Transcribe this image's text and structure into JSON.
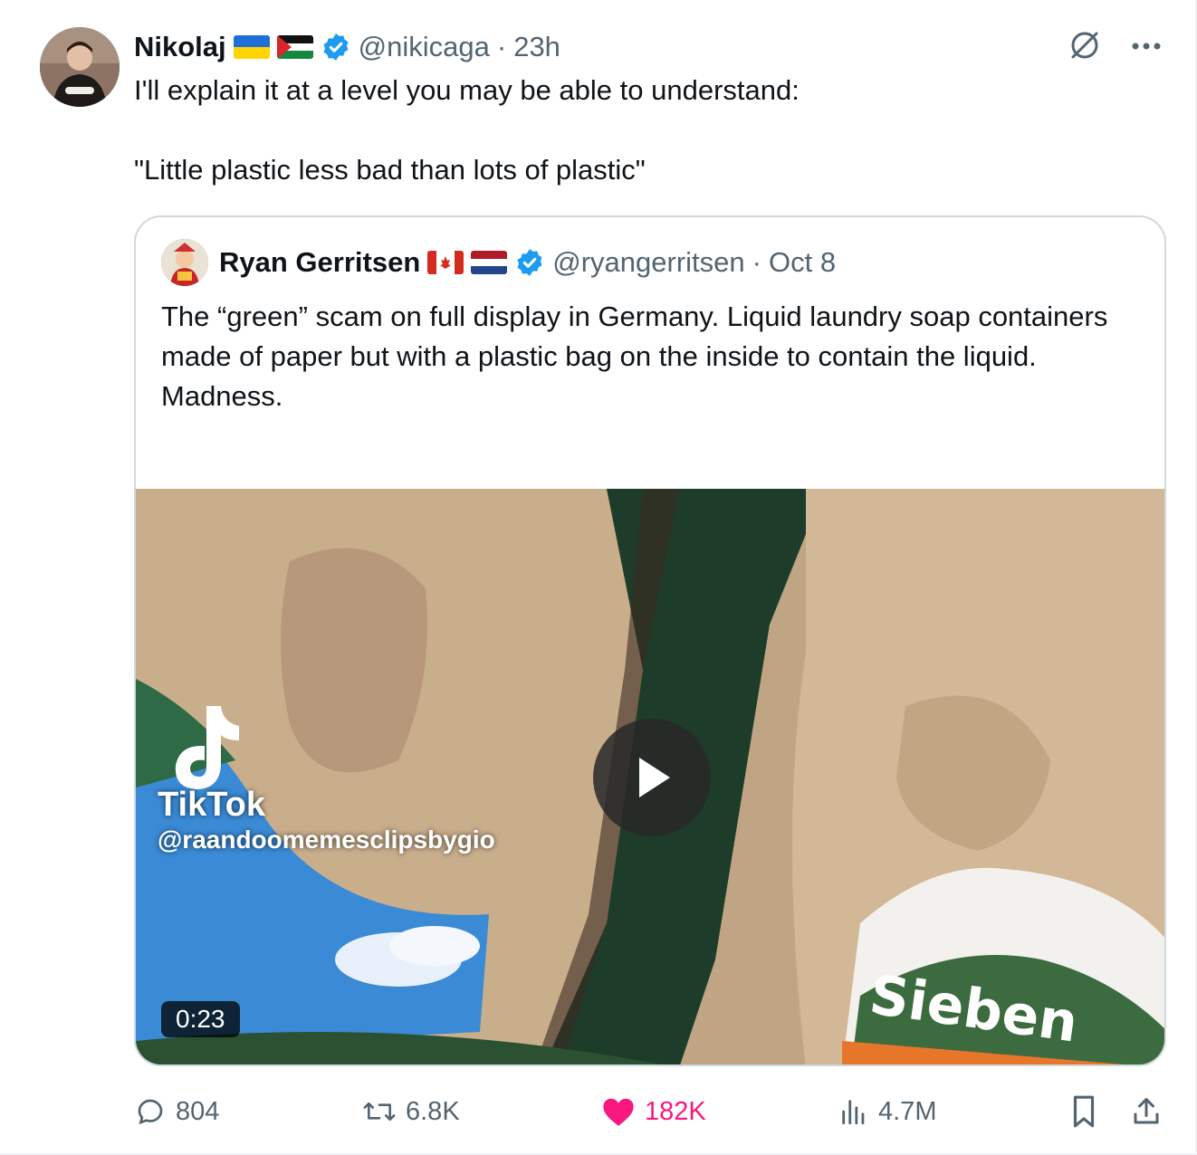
{
  "tweet": {
    "author_name": "Nikolaj",
    "handle": "@nikicaga",
    "separator": "·",
    "time": "23h",
    "text": "I'll explain it at a level you may be able to understand:\n\n\"Little plastic less bad than lots of plastic\""
  },
  "quote": {
    "author_name": "Ryan Gerritsen",
    "handle": "@ryangerritsen",
    "separator": "·",
    "date": "Oct 8",
    "text": "The “green” scam on full display in Germany. Liquid laundry soap containers made of paper but with a plastic bag on the inside to contain the liquid.\nMadness.",
    "media": {
      "duration": "0:23",
      "watermark_name": "TikTok",
      "watermark_user": "@raandoomemesclipsbygio",
      "label_text": "Sieben"
    }
  },
  "actions": {
    "replies": "804",
    "reposts": "6.8K",
    "likes": "182K",
    "views": "4.7M"
  },
  "colors": {
    "verified": "#1d9bf0",
    "like": "#f91880",
    "secondary_text": "#536471",
    "border": "#cfd9de"
  },
  "icons": [
    "grok-icon",
    "more-icon",
    "verified-icon",
    "play-icon",
    "reply-icon",
    "repost-icon",
    "like-icon",
    "views-icon",
    "bookmark-icon",
    "share-icon",
    "ukraine-flag-icon",
    "palestine-flag-icon",
    "canada-flag-icon",
    "netherlands-flag-icon"
  ]
}
